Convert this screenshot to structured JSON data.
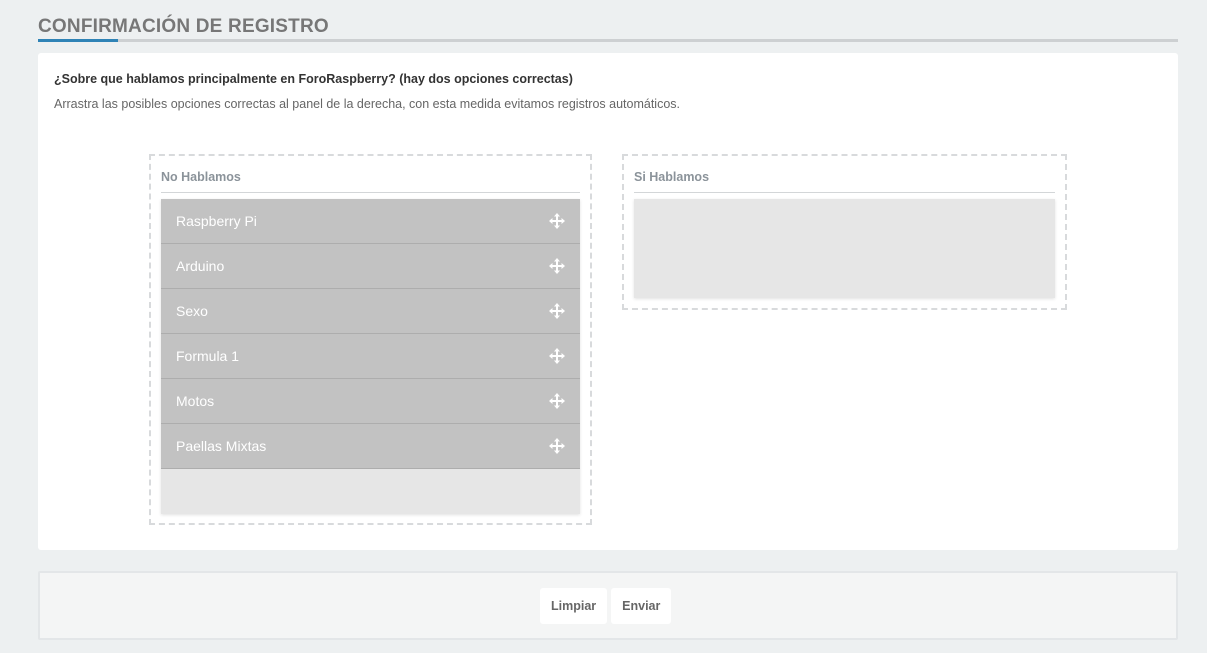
{
  "header": {
    "title": "CONFIRMACIÓN DE REGISTRO"
  },
  "form": {
    "question": "¿Sobre que hablamos principalmente en ForoRaspberry? (hay dos opciones correctas)",
    "instruction": "Arrastra las posibles opciones correctas al panel de la derecha, con esta medida evitamos registros automáticos."
  },
  "left_zone": {
    "title": "No Hablamos",
    "items": [
      {
        "label": "Raspberry Pi",
        "icon": "move-icon"
      },
      {
        "label": "Arduino",
        "icon": "move-icon"
      },
      {
        "label": "Sexo",
        "icon": "move-icon"
      },
      {
        "label": "Formula 1",
        "icon": "move-icon"
      },
      {
        "label": "Motos",
        "icon": "move-icon"
      },
      {
        "label": "Paellas Mixtas",
        "icon": "move-icon"
      }
    ]
  },
  "right_zone": {
    "title": "Si Hablamos",
    "items": []
  },
  "footer": {
    "clear_label": "Limpiar",
    "submit_label": "Enviar"
  },
  "colors": {
    "accent": "#2f83b6",
    "item_bg": "#c2c2c2",
    "page_bg": "#edf0f1"
  }
}
